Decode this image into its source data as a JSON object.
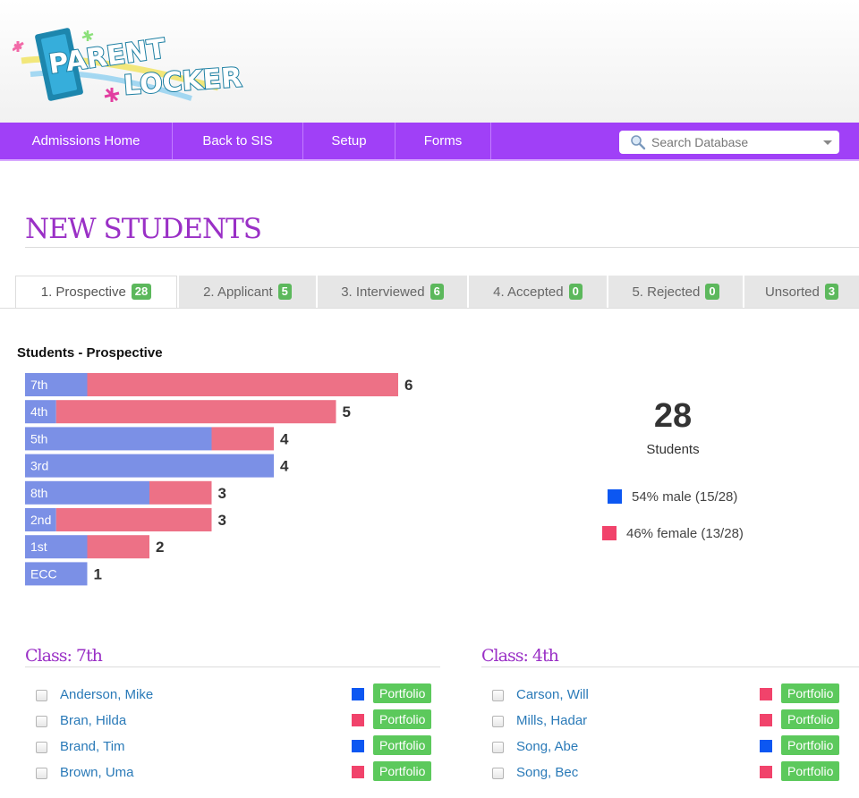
{
  "logo": {
    "text_line1": "PARENT",
    "text_line2": "LOCKER"
  },
  "colors": {
    "nav": "#a040f7",
    "accent": "#9a30c6",
    "male": "#0c57f2",
    "female": "#f1436b",
    "badge": "#5cb85c",
    "bar_male": "#7b90e6",
    "bar_female": "#ed7186"
  },
  "nav": {
    "items": [
      "Admissions Home",
      "Back to SIS",
      "Setup",
      "Forms"
    ],
    "search_placeholder": "Search Database",
    "search_icon": "search-icon"
  },
  "page_title": "NEW STUDENTS",
  "tabs": [
    {
      "label": "1. Prospective",
      "count": "28",
      "active": true
    },
    {
      "label": "2. Applicant",
      "count": "5"
    },
    {
      "label": "3. Interviewed",
      "count": "6"
    },
    {
      "label": "4. Accepted",
      "count": "0"
    },
    {
      "label": "5. Rejected",
      "count": "0"
    },
    {
      "label": "Unsorted",
      "count": "3"
    }
  ],
  "chart_title": "Students - Prospective",
  "chart_data": {
    "type": "bar",
    "orientation": "horizontal",
    "stacked": true,
    "categories": [
      "7th",
      "4th",
      "5th",
      "3rd",
      "8th",
      "2nd",
      "1st",
      "ECC"
    ],
    "series": [
      {
        "values": [
          1,
          0.5,
          3,
          4,
          2,
          0.5,
          1,
          1
        ]
      },
      {
        "values": [
          5,
          4.5,
          1,
          0,
          1,
          2.5,
          1,
          0
        ]
      }
    ],
    "totals": [
      "6",
      "5",
      "4",
      "4",
      "3",
      "3",
      "2",
      "1"
    ],
    "xlim": [
      0,
      6
    ]
  },
  "summary": {
    "total": "28",
    "total_label": "Students",
    "male_text": "54% male (15/28)",
    "female_text": "46% female (13/28)"
  },
  "classes": [
    {
      "title": "Class: 7th",
      "students": [
        {
          "name": "Anderson, Mike",
          "gender": "male",
          "button": "Portfolio"
        },
        {
          "name": "Bran, Hilda",
          "gender": "female",
          "button": "Portfolio"
        },
        {
          "name": "Brand, Tim",
          "gender": "male",
          "button": "Portfolio"
        },
        {
          "name": "Brown, Uma",
          "gender": "female",
          "button": "Portfolio"
        }
      ]
    },
    {
      "title": "Class: 4th",
      "students": [
        {
          "name": "Carson, Will",
          "gender": "female",
          "button": "Portfolio"
        },
        {
          "name": "Mills, Hadar",
          "gender": "female",
          "button": "Portfolio"
        },
        {
          "name": "Song, Abe",
          "gender": "male",
          "button": "Portfolio"
        },
        {
          "name": "Song, Bec",
          "gender": "female",
          "button": "Portfolio"
        }
      ]
    }
  ]
}
